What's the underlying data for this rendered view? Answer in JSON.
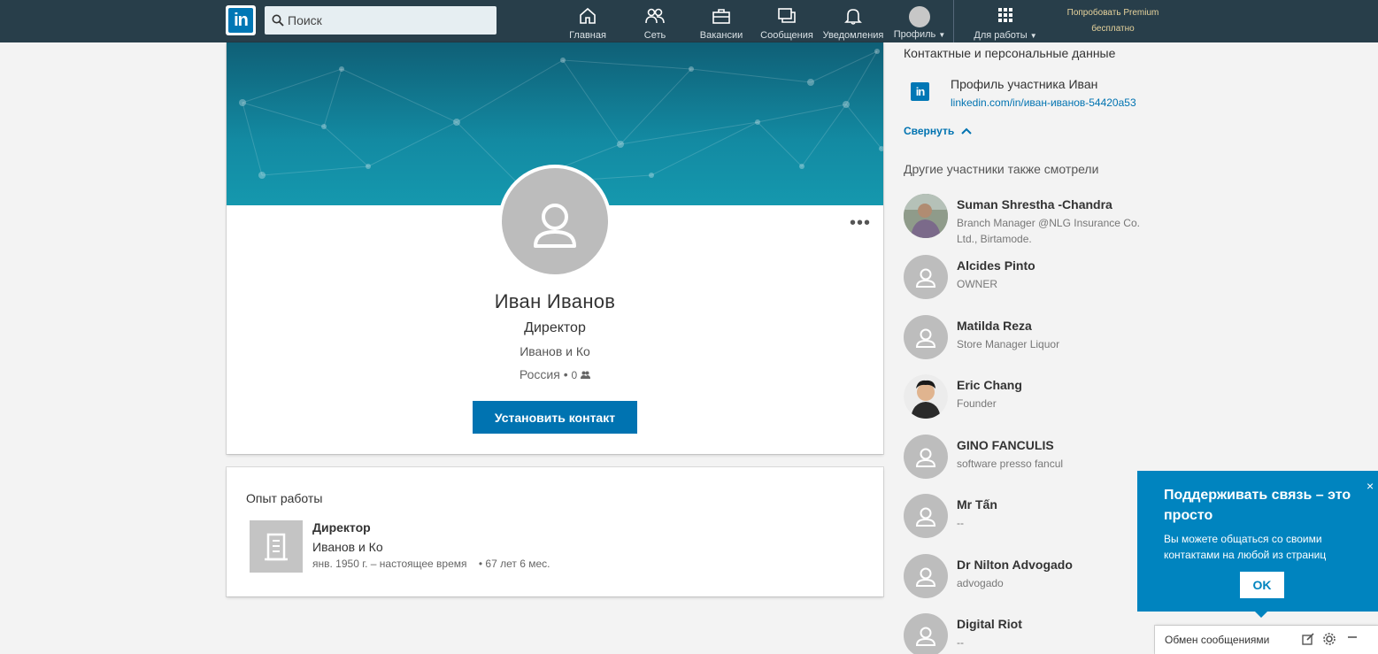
{
  "nav": {
    "logo_text": "in",
    "search_placeholder": "Поиск",
    "items": [
      {
        "label": "Главная",
        "icon": "home-icon"
      },
      {
        "label": "Сеть",
        "icon": "network-icon"
      },
      {
        "label": "Вакансии",
        "icon": "briefcase-icon"
      },
      {
        "label": "Сообщения",
        "icon": "messages-icon"
      },
      {
        "label": "Уведомления",
        "icon": "bell-icon"
      },
      {
        "label": "Профиль",
        "icon": "avatar-icon"
      },
      {
        "label": "Для работы",
        "icon": "grid-icon"
      }
    ],
    "premium_line1": "Попробовать Premium",
    "premium_line2": "бесплатно"
  },
  "profile": {
    "name": "Иван Иванов",
    "title": "Директор",
    "company": "Иванов и Ко",
    "location": "Россия",
    "connections": "0",
    "connect_button": "Установить контакт",
    "more_label": "•••"
  },
  "experience": {
    "heading": "Опыт работы",
    "title": "Директор",
    "company": "Иванов и Ко",
    "dates": "янв. 1950 г. – настоящее время",
    "duration": "67 лет 6 мес."
  },
  "contact": {
    "heading": "Контактные и персональные данные",
    "logo_text": "in",
    "label": "Профиль участника Иван",
    "link": "linkedin.com/in/иван-иванов-54420a53",
    "collapse": "Свернуть"
  },
  "peers": {
    "heading": "Другие участники также смотрели",
    "items": [
      {
        "name": "Suman Shrestha -Chandra",
        "desc": "Branch Manager @NLG Insurance Co. Ltd., Birtamode.",
        "photo": "photo"
      },
      {
        "name": "Alcides Pinto",
        "desc": "OWNER",
        "photo": "placeholder"
      },
      {
        "name": "Matilda Reza",
        "desc": "Store Manager Liquor",
        "photo": "placeholder"
      },
      {
        "name": "Eric Chang",
        "desc": "Founder",
        "photo": "photo"
      },
      {
        "name": "GINO FANCULIS",
        "desc": "software presso fancul",
        "photo": "placeholder"
      },
      {
        "name": "Mr Tấn",
        "desc": "--",
        "photo": "placeholder"
      },
      {
        "name": "Dr Nilton Advogado",
        "desc": "advogado",
        "photo": "placeholder"
      },
      {
        "name": "Digital Riot",
        "desc": "--",
        "photo": "placeholder"
      }
    ]
  },
  "popup": {
    "title": "Поддерживать связь – это просто",
    "body": "Вы можете общаться со своими контактами на любой из страниц",
    "ok": "OK",
    "close": "×"
  },
  "messaging": {
    "label": "Обмен сообщениями"
  },
  "colors": {
    "nav_bg": "#283e4a",
    "brand_blue": "#0073b1",
    "popup_blue": "#0084bf",
    "premium_gold": "#e7d39c"
  }
}
